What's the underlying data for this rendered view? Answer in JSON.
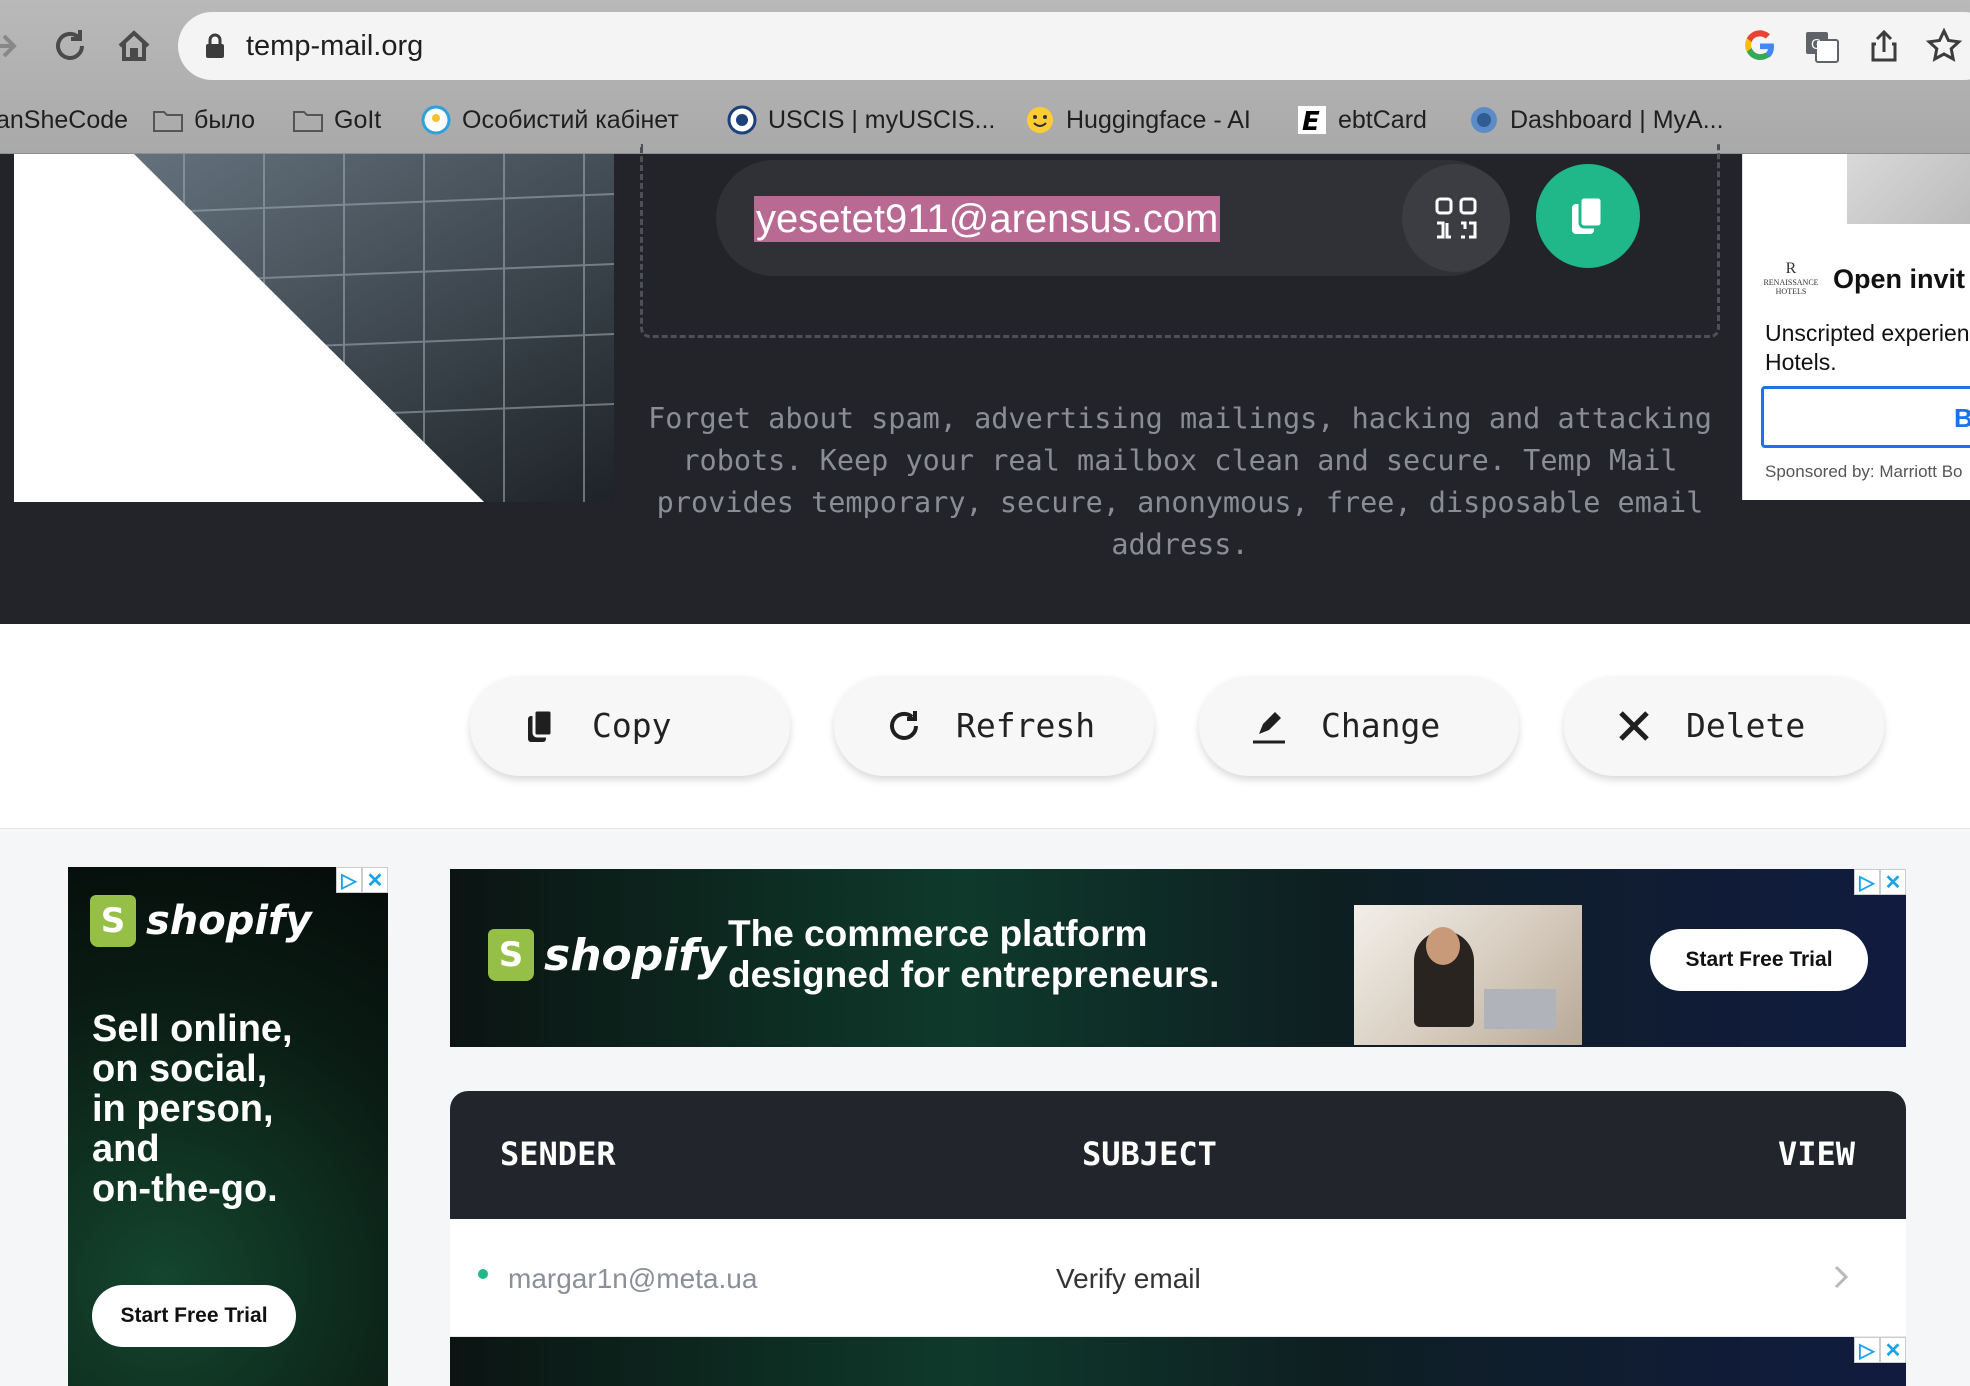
{
  "browser": {
    "url": "temp-mail.org",
    "bookmarks": [
      {
        "label": "anSheCode"
      },
      {
        "label": "было"
      },
      {
        "label": "GoIt"
      },
      {
        "label": "Особистий кабінет"
      },
      {
        "label": "USCIS | myUSCIS..."
      },
      {
        "label": "Huggingface - AI"
      },
      {
        "label": "ebtCard"
      },
      {
        "label": "Dashboard | MyA..."
      }
    ]
  },
  "hero": {
    "email": "yesetet911@arensus.com",
    "tagline": "Forget about spam, advertising mailings, hacking and attacking robots. Keep your real mailbox clean and secure. Temp Mail provides temporary, secure, anonymous, free, disposable email address."
  },
  "ad_right": {
    "logo": "RENAISSANCE HOTELS",
    "title": "Open invit",
    "body": "Unscripted experien Hotels.",
    "button": "B",
    "sponsored": "Sponsored by: Marriott Bo"
  },
  "actions": [
    {
      "label": "Copy",
      "icon": "copy-icon"
    },
    {
      "label": "Refresh",
      "icon": "refresh-icon"
    },
    {
      "label": "Change",
      "icon": "edit-icon"
    },
    {
      "label": "Delete",
      "icon": "close-icon"
    }
  ],
  "ads": {
    "side": {
      "brand": "shopify",
      "text": "Sell online, on social, in person, and on-the-go.",
      "cta": "Start Free Trial"
    },
    "banner": {
      "brand": "shopify",
      "headline_1": "The commerce platform",
      "headline_2": "designed for entrepreneurs.",
      "cta": "Start Free Trial"
    }
  },
  "inbox": {
    "columns": {
      "sender": "SENDER",
      "subject": "SUBJECT",
      "view": "VIEW"
    },
    "rows": [
      {
        "sender": "margar1n@meta.ua",
        "subject": "Verify email"
      }
    ]
  },
  "colors": {
    "accent": "#21b889",
    "dark": "#22242a",
    "highlight": "#b86a92"
  }
}
